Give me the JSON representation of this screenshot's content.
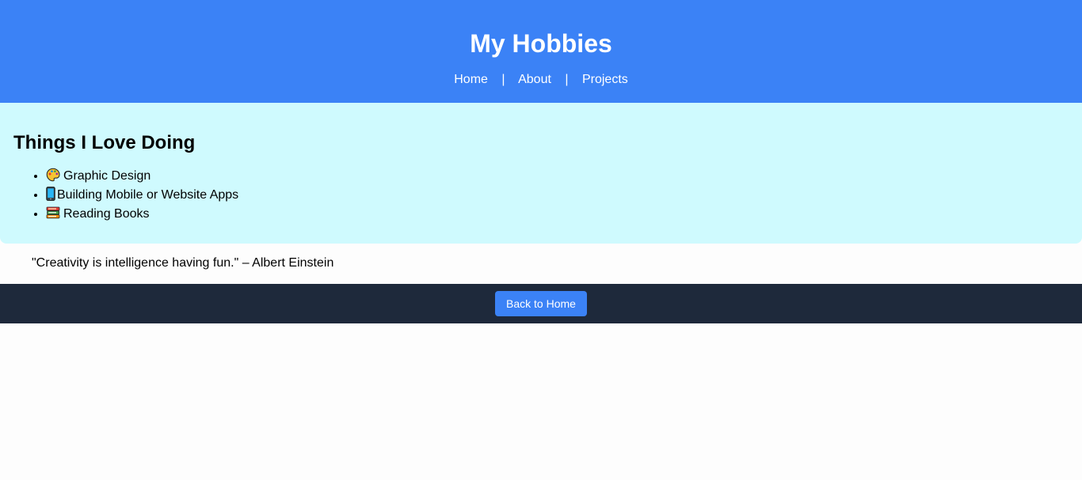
{
  "header": {
    "title": "My Hobbies",
    "nav": [
      {
        "label": "Home"
      },
      {
        "label": "About"
      },
      {
        "label": "Projects"
      }
    ],
    "separator": "|"
  },
  "hobbies": {
    "heading": "Things I Love Doing",
    "items": [
      {
        "icon": "palette-icon",
        "label": "Graphic Design"
      },
      {
        "icon": "mobile-phone-icon",
        "label": "Building Mobile or Website Apps"
      },
      {
        "icon": "books-icon",
        "label": "Reading Books"
      }
    ]
  },
  "quote": {
    "text": "\"Creativity is intelligence having fun.\" – Albert Einstein"
  },
  "footer": {
    "button_label": "Back to Home"
  },
  "colors": {
    "header_bg": "#3b82f6",
    "section_bg": "#cffafe",
    "footer_bg": "#1e293b",
    "button_bg": "#3b82f6"
  }
}
